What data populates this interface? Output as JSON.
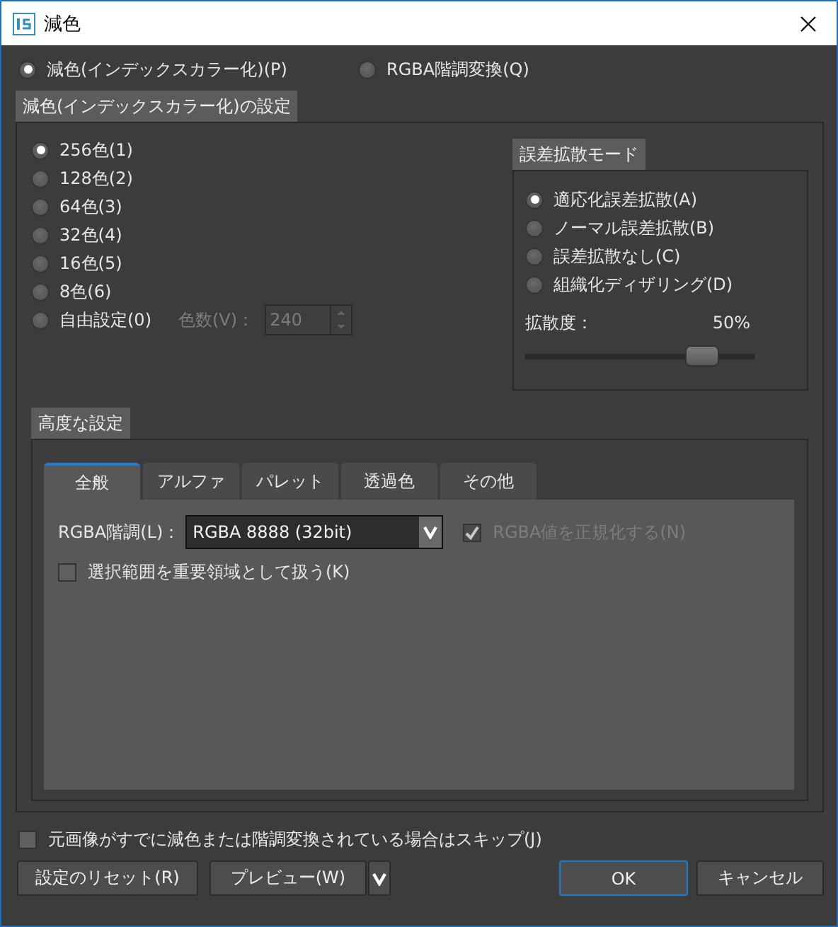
{
  "window": {
    "title": "減色"
  },
  "mode_options": [
    {
      "label": "減色(インデックスカラー化)(P)",
      "selected": true
    },
    {
      "label": "RGBA階調変換(Q)",
      "selected": false
    }
  ],
  "index_settings": {
    "title": "減色(インデックスカラー化)の設定",
    "colors": [
      {
        "label": "256色(1)",
        "selected": true
      },
      {
        "label": "128色(2)",
        "selected": false
      },
      {
        "label": "64色(3)",
        "selected": false
      },
      {
        "label": "32色(4)",
        "selected": false
      },
      {
        "label": "16色(5)",
        "selected": false
      },
      {
        "label": "8色(6)",
        "selected": false
      },
      {
        "label": "自由設定(0)",
        "selected": false
      }
    ],
    "count": {
      "label": "色数(V)：",
      "value": "240",
      "disabled": true
    }
  },
  "dither": {
    "title": "誤差拡散モード",
    "options": [
      {
        "label": "適応化誤差拡散(A)",
        "selected": true
      },
      {
        "label": "ノーマル誤差拡散(B)",
        "selected": false
      },
      {
        "label": "誤差拡散なし(C)",
        "selected": false
      },
      {
        "label": "組織化ディザリング(D)",
        "selected": false
      }
    ],
    "strength_label": "拡散度：",
    "strength_value": "50%",
    "level": 0.77
  },
  "advanced": {
    "title": "高度な設定",
    "tabs": [
      {
        "label": "全般",
        "selected": true
      },
      {
        "label": "アルファ",
        "selected": false
      },
      {
        "label": "パレット",
        "selected": false
      },
      {
        "label": "透過色",
        "selected": false
      },
      {
        "label": "その他",
        "selected": false
      }
    ],
    "rgba_label": "RGBA階調(L)：",
    "rgba_value": "RGBA 8888 (32bit)",
    "normalize": {
      "label": "RGBA値を正規化する(N)",
      "checked": true,
      "disabled": true
    },
    "important_area": {
      "label": "選択範囲を重要領域として扱う(K)",
      "checked": false
    }
  },
  "skip": {
    "label": "元画像がすでに減色または階調変換されている場合はスキップ(J)",
    "checked": false
  },
  "buttons": [
    {
      "kind": "reset",
      "label": "設定のリセット(R)"
    },
    {
      "kind": "preview",
      "label": "プレビュー(W)"
    },
    {
      "kind": "ok",
      "label": "OK"
    },
    {
      "kind": "cancel",
      "label": "キャンセル"
    }
  ]
}
